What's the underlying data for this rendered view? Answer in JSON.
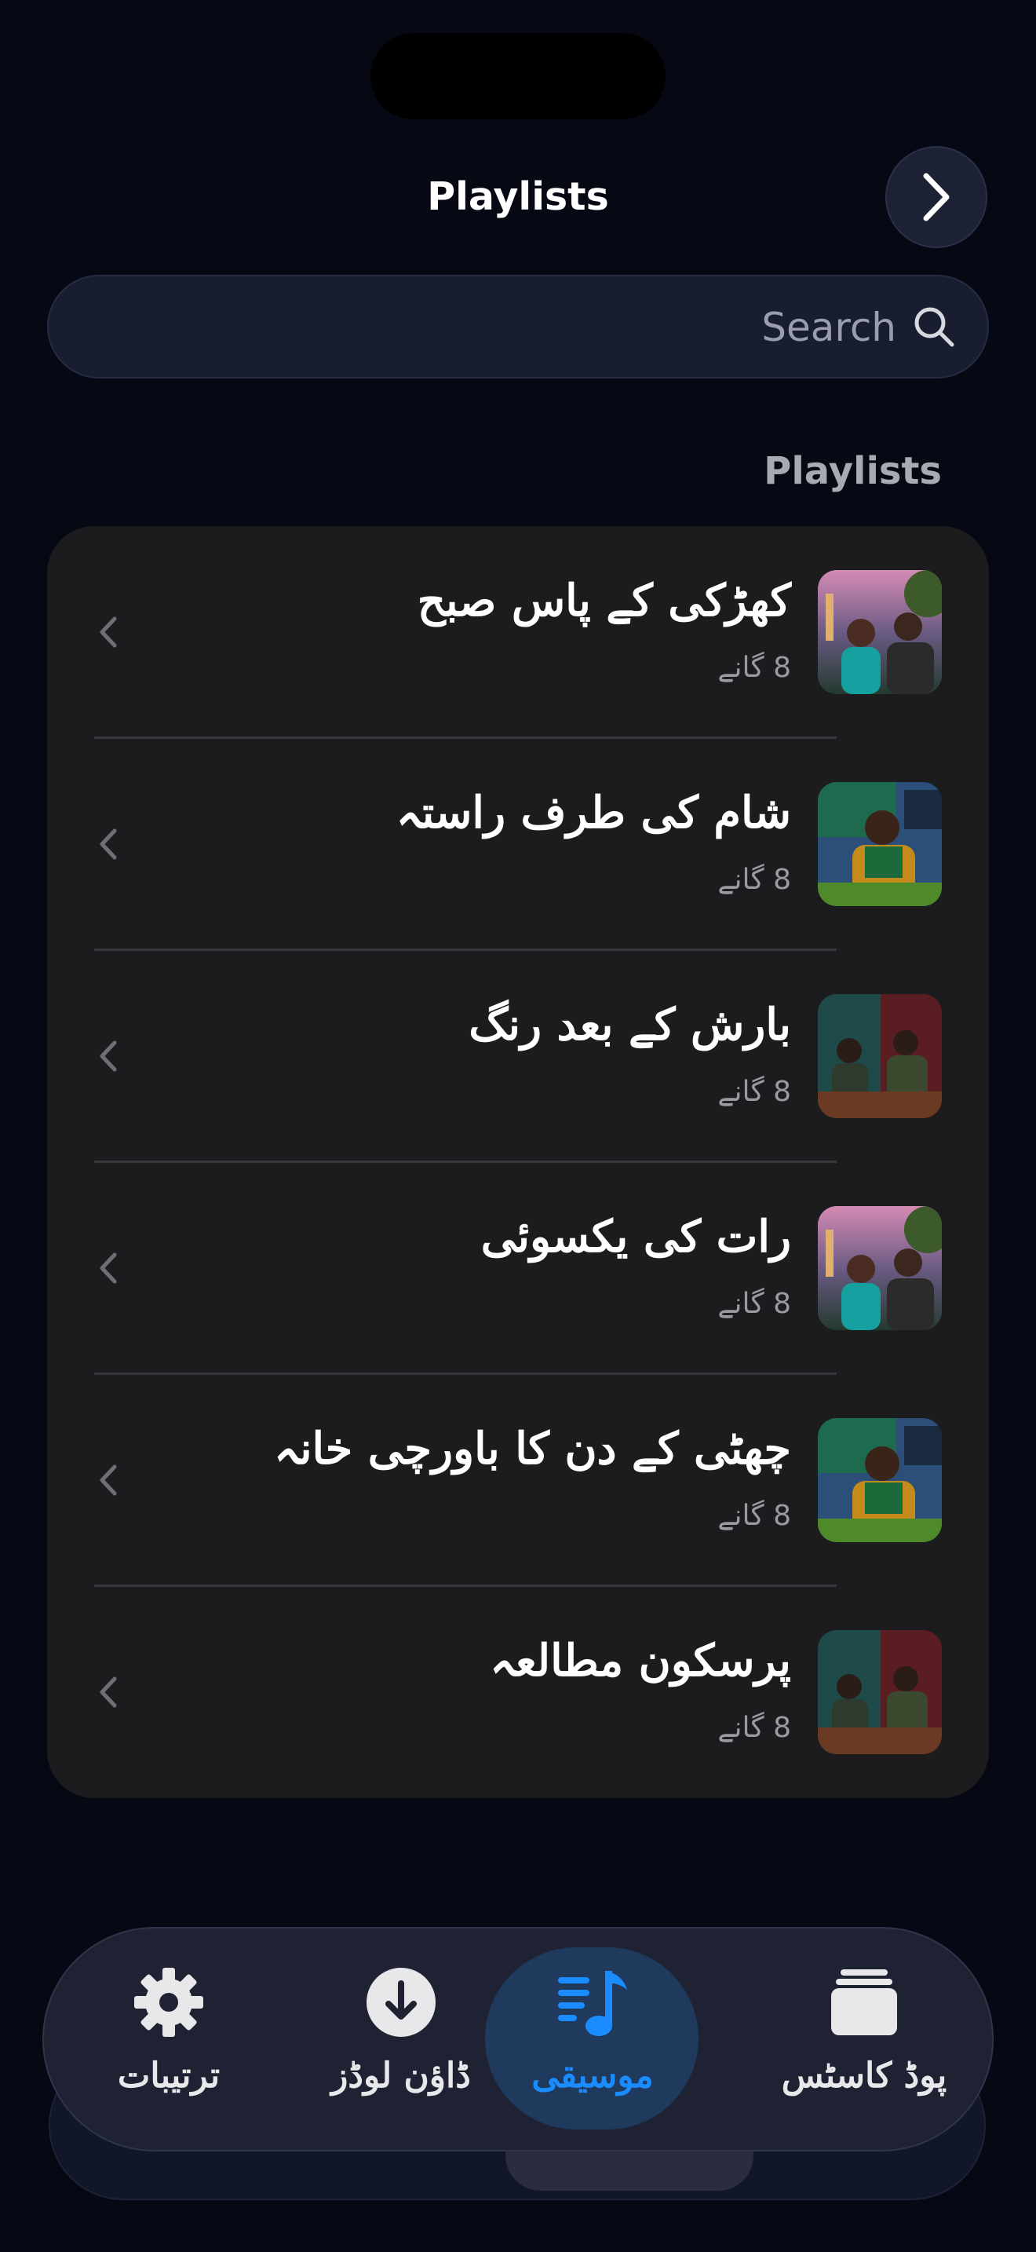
{
  "header": {
    "title": "Playlists"
  },
  "search": {
    "placeholder": "Search"
  },
  "section": {
    "title": "Playlists"
  },
  "playlists": [
    {
      "title": "کھڑکی کے پاس صبح",
      "subtitle": "8 گانے"
    },
    {
      "title": "شام کی طرف راستہ",
      "subtitle": "8 گانے"
    },
    {
      "title": "بارش کے بعد رنگ",
      "subtitle": "8 گانے"
    },
    {
      "title": "رات کی یکسوئی",
      "subtitle": "8 گانے"
    },
    {
      "title": "چھٹی کے دن کا باورچی خانہ",
      "subtitle": "8 گانے"
    },
    {
      "title": "پرسکون مطالعہ",
      "subtitle": "8 گانے"
    }
  ],
  "tabs": {
    "settings": {
      "label": "ترتیبات",
      "icon": "gear-icon"
    },
    "downloads": {
      "label": "ڈاؤن لوڈز",
      "icon": "download-icon"
    },
    "music": {
      "label": "موسیقی",
      "icon": "music-notes-icon"
    },
    "podcasts": {
      "label": "پوڈ کاسٹس",
      "icon": "stack-icon"
    }
  },
  "colors": {
    "accent": "#1a8cff",
    "background": "#060814",
    "card": "#1c1c1e"
  }
}
